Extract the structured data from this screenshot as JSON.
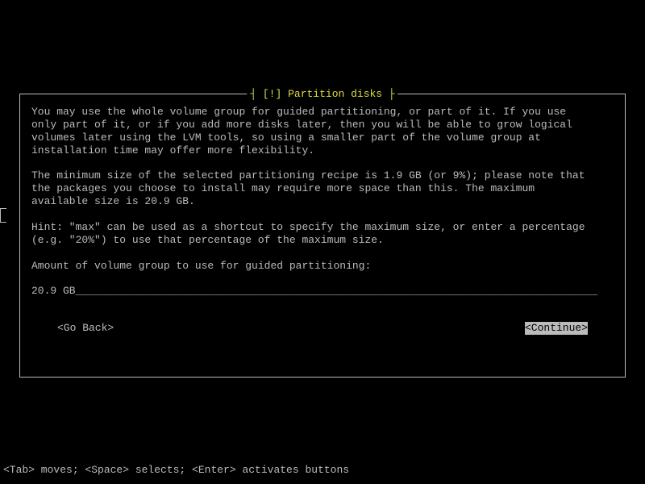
{
  "dialog": {
    "title": "[!] Partition disks",
    "paragraph1": "You may use the whole volume group for guided partitioning, or part of it. If you use\nonly part of it, or if you add more disks later, then you will be able to grow logical\nvolumes later using the LVM tools, so using a smaller part of the volume group at\ninstallation time may offer more flexibility.",
    "paragraph2": "The minimum size of the selected partitioning recipe is 1.9 GB (or 9%); please note that\nthe packages you choose to install may require more space than this. The maximum\navailable size is 20.9 GB.",
    "paragraph3": "Hint: \"max\" can be used as a shortcut to specify the maximum size, or enter a percentage\n(e.g. \"20%\") to use that percentage of the maximum size.",
    "prompt": "Amount of volume group to use for guided partitioning:",
    "inputValue": "20.9 GB___________________________________________________________________________________",
    "goBack": "<Go Back>",
    "continue": "<Continue>"
  },
  "helpLine": "<Tab> moves; <Space> selects; <Enter> activates buttons"
}
